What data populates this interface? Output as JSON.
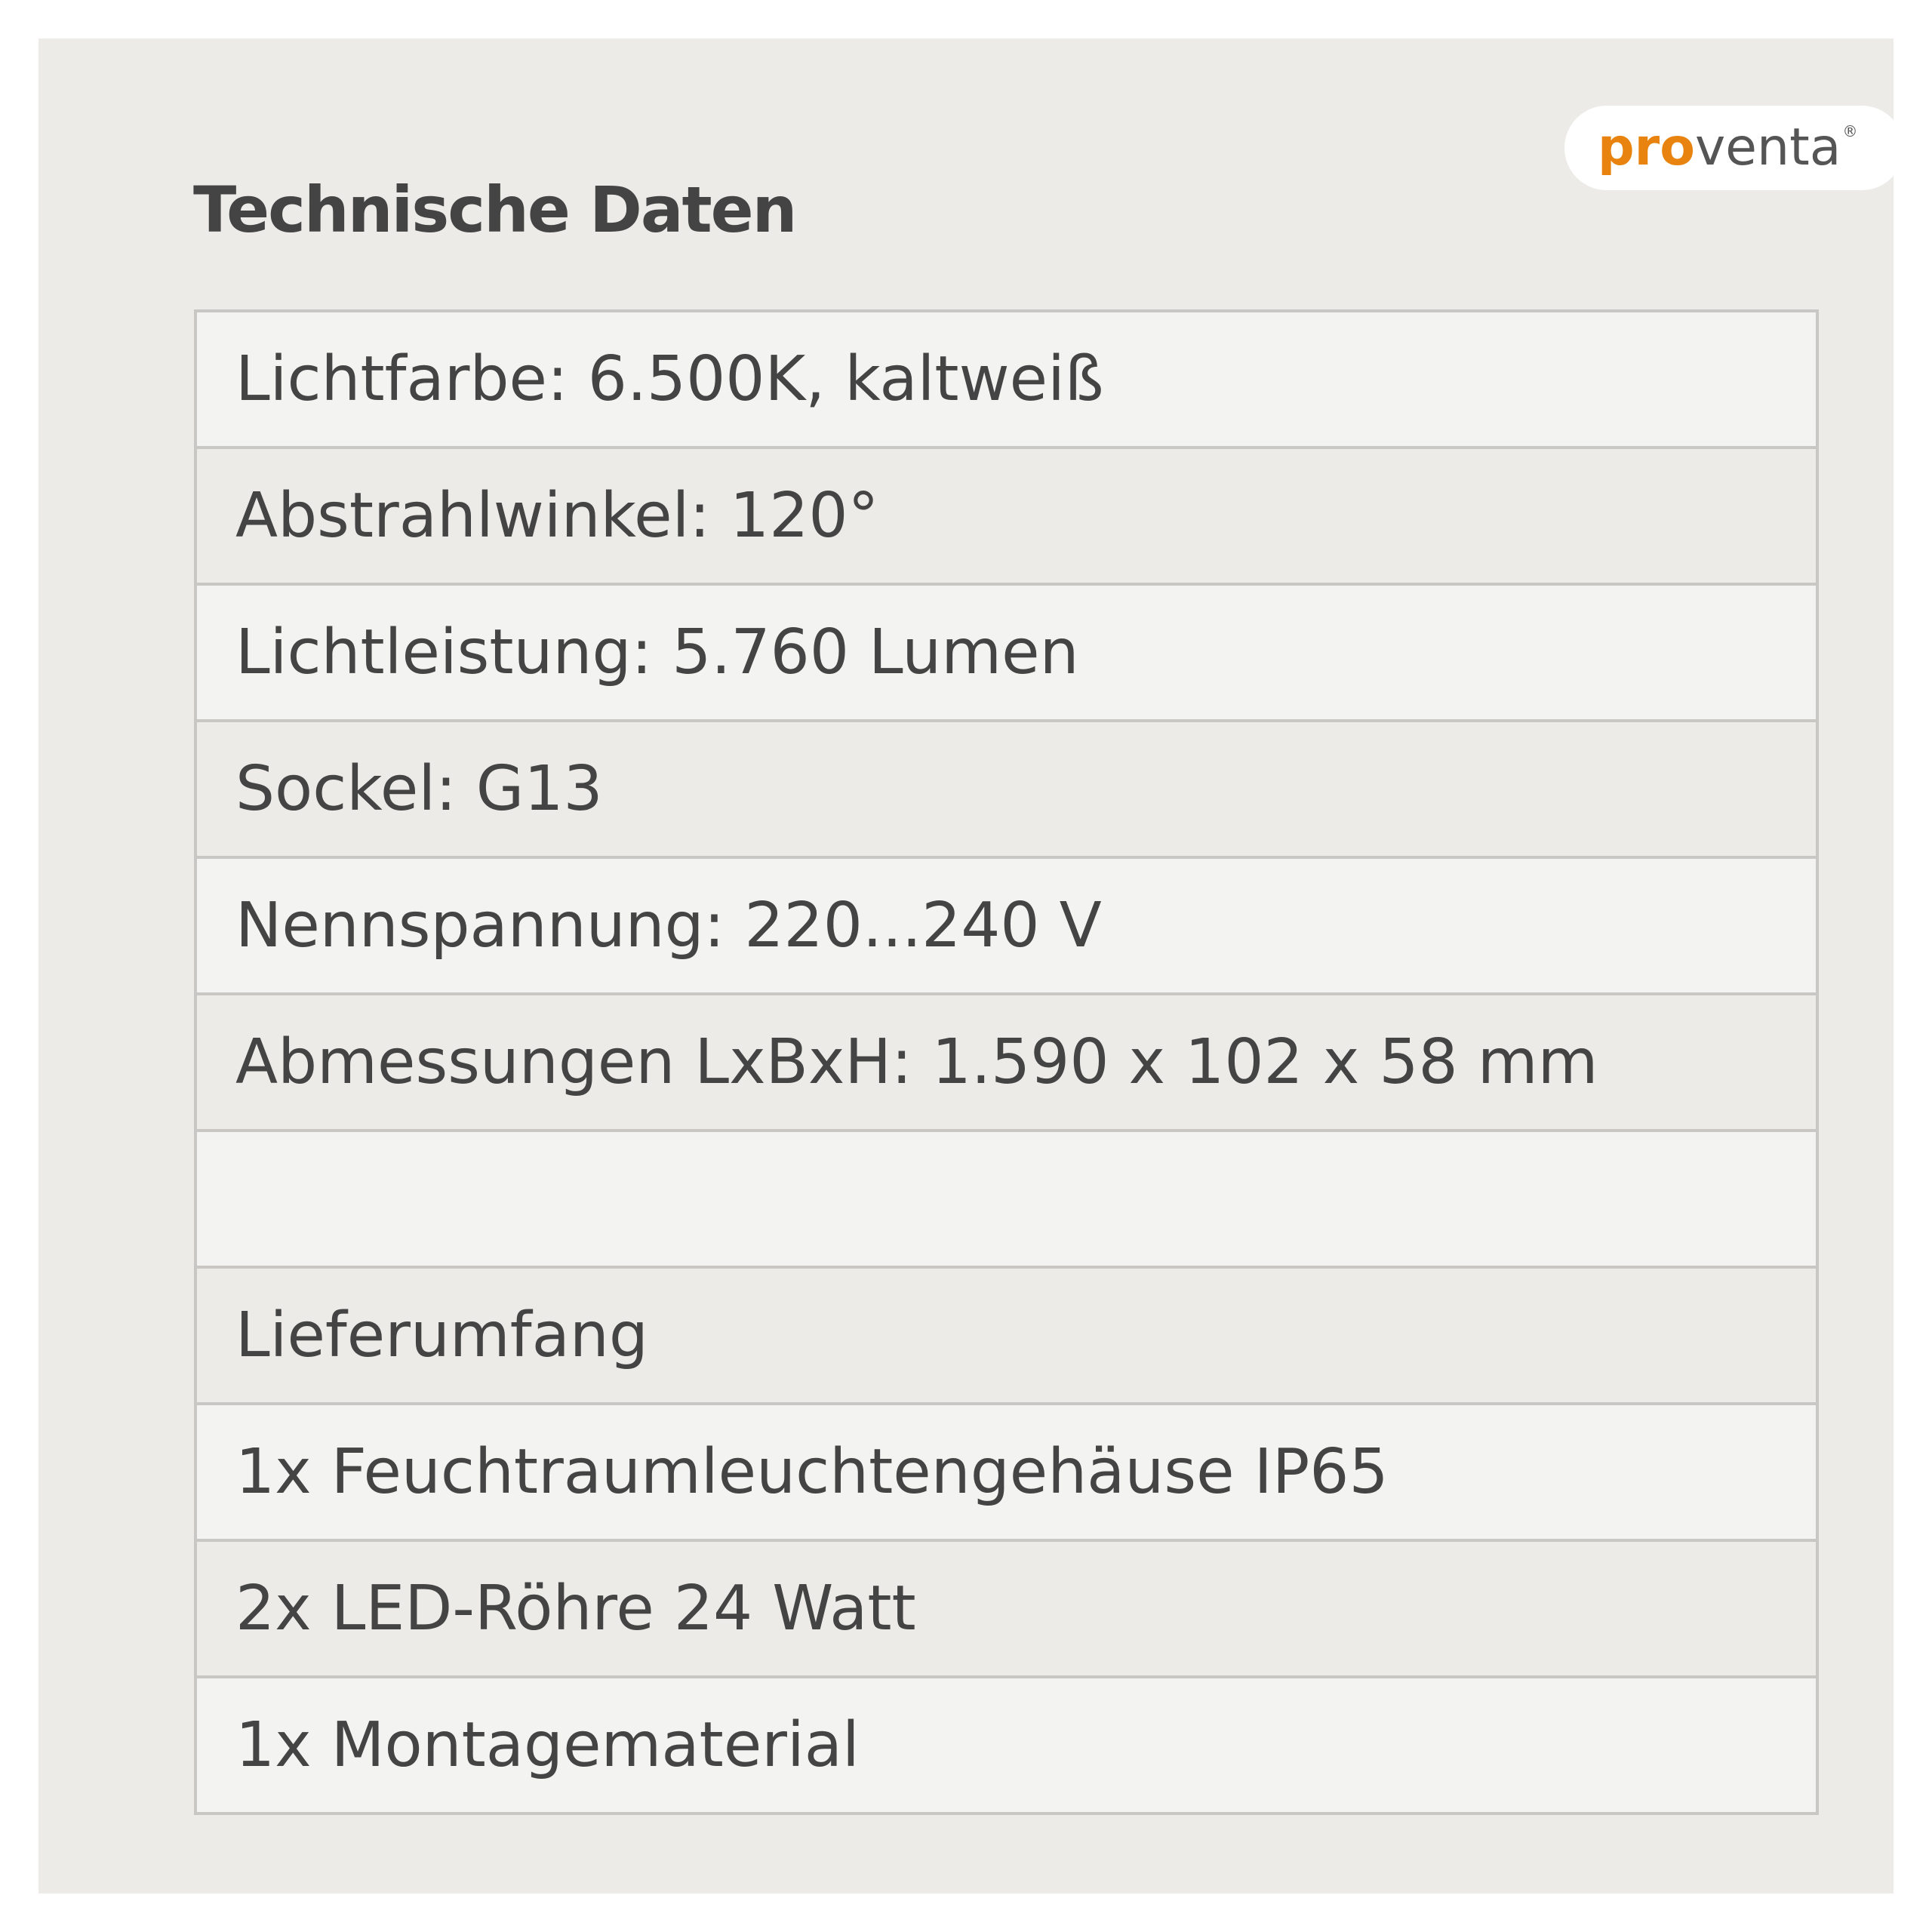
{
  "title": "Technische Daten",
  "logo": {
    "part1": "pro",
    "part2": "venta",
    "registered": "®",
    "colors": {
      "pro": "#e8830f",
      "venta": "#555555"
    }
  },
  "rows": [
    "Lichtfarbe: 6.500K, kaltweiß",
    "Abstrahlwinkel: 120°",
    "Lichtleistung: 5.760 Lumen",
    "Sockel: G13",
    "Nennspannung: 220...240 V",
    "Abmessungen LxBxH: 1.590 x 102 x 58 mm",
    "",
    "Lieferumfang",
    "1x Feuchtraumleuchtengehäuse IP65",
    "2x LED-Röhre 24 Watt",
    "1x Montagematerial"
  ]
}
